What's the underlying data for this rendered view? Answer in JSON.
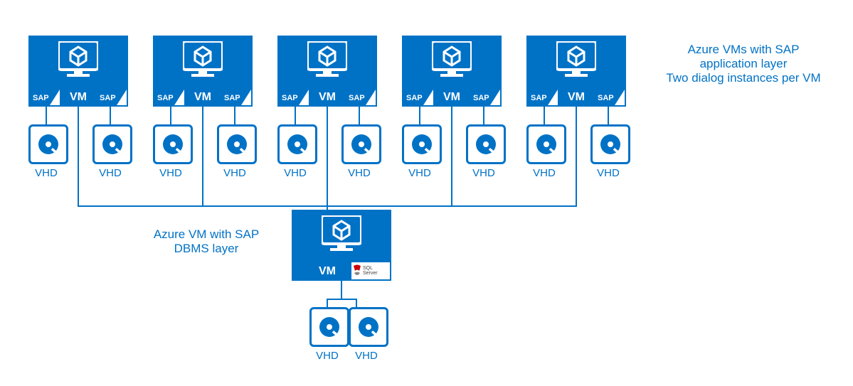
{
  "vm_label": "VM",
  "vhd_label": "VHD",
  "sap_label": "SAP",
  "caption_app": "Azure VMs with SAP application layer\nTwo dialog instances per VM",
  "caption_db": "Azure VM with SAP DBMS layer",
  "sql_label": "SQL Server",
  "colors": {
    "azure_blue": "#0072c6"
  },
  "layout": {
    "row_vm_count": 5,
    "vhds_per_app_vm": 2,
    "vhds_per_db_vm": 2
  }
}
